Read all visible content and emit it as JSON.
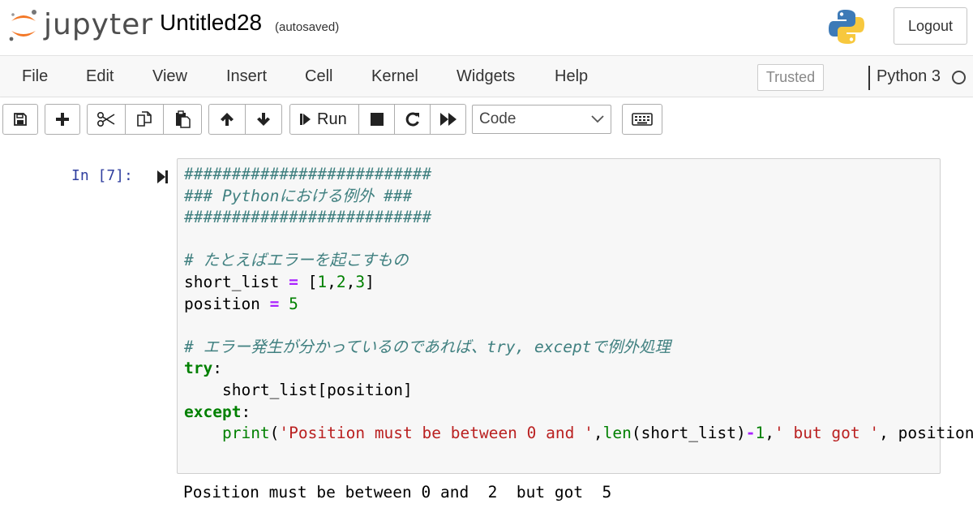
{
  "header": {
    "logo_text": "jupyter",
    "notebook_name": "Untitled28",
    "autosave_status": "(autosaved)",
    "logout_label": "Logout"
  },
  "menubar": {
    "items": [
      "File",
      "Edit",
      "View",
      "Insert",
      "Cell",
      "Kernel",
      "Widgets",
      "Help"
    ],
    "trusted_label": "Trusted",
    "kernel_name": "Python 3"
  },
  "toolbar": {
    "run_label": "Run",
    "cell_type": "Code"
  },
  "cell": {
    "prompt": "In [7]:",
    "code": {
      "line1": "##########################",
      "line2": "### Pythonにおける例外 ###",
      "line3": "##########################",
      "line5": "# たとえばエラーを起こすもの",
      "line6_var": "short_list",
      "line6_op": "=",
      "line6_open": "[",
      "line6_n1": "1",
      "line6_n2": "2",
      "line6_n3": "3",
      "line6_close": "]",
      "line6_comma": ",",
      "line7_var": "position",
      "line7_op": "=",
      "line7_val": "5",
      "line9": "# エラー発生が分かっているのであれば、try, exceptで例外処理",
      "line10_kw": "try",
      "line10_colon": ":",
      "line11": "short_list[position]",
      "line12_kw": "except",
      "line12_colon": ":",
      "line13_print": "print",
      "line13_paren_open": "(",
      "line13_str1": "'Position must be between 0 and '",
      "line13_comma": ",",
      "line13_len": "len",
      "line13_len_arg": "(short_list)",
      "line13_minus": "-",
      "line13_one": "1",
      "line13_str2": "' but got '",
      "line13_tail": ", position)"
    },
    "output": "Position must be between 0 and  2  but got  5"
  },
  "colors": {
    "comment": "#408080",
    "keyword": "#008000",
    "operator": "#aa22ff",
    "string": "#ba2121",
    "prompt": "#303f9f",
    "jupyter_orange": "#f37726"
  }
}
